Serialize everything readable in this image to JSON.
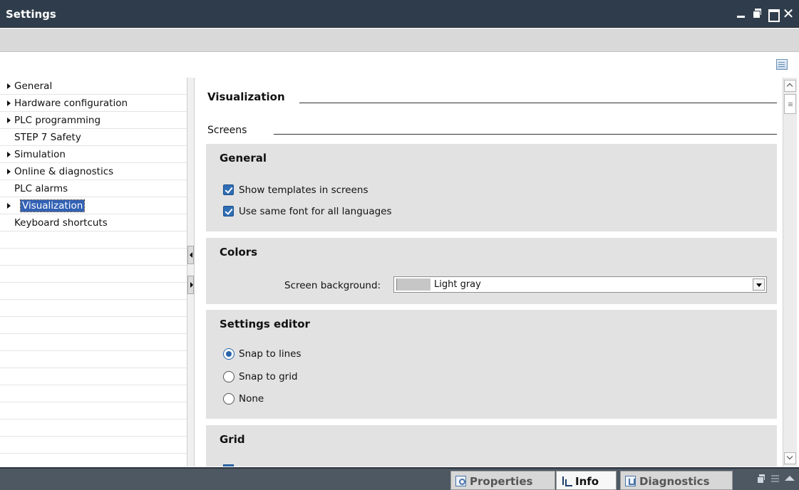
{
  "window": {
    "title": "Settings",
    "controls": [
      "minimize-icon",
      "float-icon",
      "maximize-icon",
      "close-icon"
    ],
    "close_glyph": "✕"
  },
  "nav": {
    "items": [
      {
        "label": "General",
        "expandable": true,
        "selected": false
      },
      {
        "label": "Hardware configuration",
        "expandable": true,
        "selected": false
      },
      {
        "label": "PLC programming",
        "expandable": true,
        "selected": false
      },
      {
        "label": "STEP 7 Safety",
        "expandable": false,
        "selected": false
      },
      {
        "label": "Simulation",
        "expandable": true,
        "selected": false
      },
      {
        "label": "Online & diagnostics",
        "expandable": true,
        "selected": false
      },
      {
        "label": "PLC alarms",
        "expandable": false,
        "selected": false
      },
      {
        "label": "Visualization",
        "expandable": true,
        "selected": true
      },
      {
        "label": "Keyboard shortcuts",
        "expandable": false,
        "selected": false
      }
    ]
  },
  "content": {
    "section_title": "Visualization",
    "subsection_title": "Screens",
    "general": {
      "title": "General",
      "options": [
        {
          "label": "Show templates in screens",
          "checked": true
        },
        {
          "label": "Use same font for all languages",
          "checked": true
        }
      ]
    },
    "colors": {
      "title": "Colors",
      "screen_background_label": "Screen background:",
      "screen_background_value": "Light gray",
      "swatch_color": "#c6c6c6"
    },
    "settings_editor": {
      "title": "Settings editor",
      "options": [
        {
          "label": "Snap to lines",
          "selected": true
        },
        {
          "label": "Snap to grid",
          "selected": false
        },
        {
          "label": "None",
          "selected": false
        }
      ]
    },
    "grid": {
      "title": "Grid"
    }
  },
  "bottom_tabs": [
    {
      "label": "Properties",
      "active": false,
      "icon": "properties-icon"
    },
    {
      "label": "Info",
      "active": true,
      "icon": "info-icon"
    },
    {
      "label": "Diagnostics",
      "active": false,
      "icon": "diagnostics-icon"
    }
  ],
  "colors": {
    "titlebar": "#2f3c4b",
    "selection": "#3261b4",
    "group_bg": "#e2e2e2",
    "bottom_bar": "#4d5863"
  }
}
